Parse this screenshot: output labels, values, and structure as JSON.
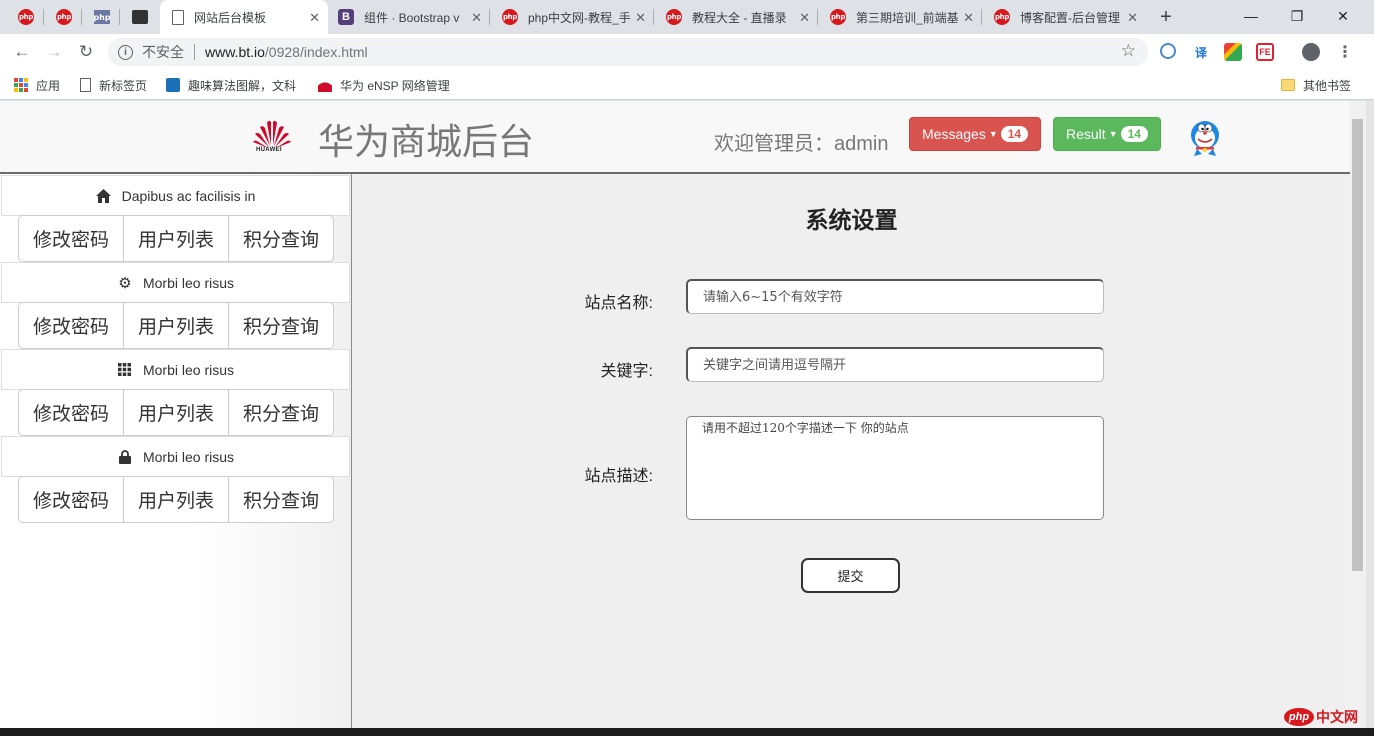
{
  "browser": {
    "tabs": [
      {
        "title": "网站后台模板",
        "active": true
      },
      {
        "title": "组件 · Bootstrap v"
      },
      {
        "title": "php中文网-教程_手"
      },
      {
        "title": "教程大全 - 直播录"
      },
      {
        "title": "第三期培训_前端基"
      },
      {
        "title": "博客配置-后台管理"
      }
    ],
    "pinned_tab_icons": [
      "php-icon",
      "php-icon",
      "php-box-icon",
      "github-icon"
    ],
    "security_label": "不安全",
    "url_host": "www.bt.io",
    "url_path": "/0928/index.html",
    "bookmarks": {
      "apps": "应用",
      "newtab": "新标签页",
      "algo": "趣味算法图解，文科",
      "huawei": "华为 eNSP 网络管理",
      "other": "其他书签"
    },
    "ext_translate": "译",
    "ext_fe": "FE"
  },
  "header": {
    "logo_word": "HUAWEI",
    "title": "华为商城后台",
    "welcome": "欢迎管理员：admin",
    "messages_label": "Messages",
    "messages_count": "14",
    "result_label": "Result",
    "result_count": "14"
  },
  "sidebar": {
    "panels": [
      {
        "heading": "Dapibus ac facilisis in",
        "icon": "home-icon",
        "buttons": [
          "修改密码",
          "用户列表",
          "积分查询"
        ]
      },
      {
        "heading": "Morbi leo risus",
        "icon": "gear-icon",
        "buttons": [
          "修改密码",
          "用户列表",
          "积分查询"
        ]
      },
      {
        "heading": "Morbi leo risus",
        "icon": "grid-icon",
        "buttons": [
          "修改密码",
          "用户列表",
          "积分查询"
        ]
      },
      {
        "heading": "Morbi leo risus",
        "icon": "lock-icon",
        "buttons": [
          "修改密码",
          "用户列表",
          "积分查询"
        ]
      }
    ]
  },
  "form": {
    "title": "系统设置",
    "site_name_label": "站点名称:",
    "site_name_placeholder": "请输入6~15个有效字符",
    "keywords_label": "关键字:",
    "keywords_placeholder": "关键字之间请用逗号隔开",
    "description_label": "站点描述:",
    "description_placeholder": "请用不超过120个字描述一下 你的站点",
    "submit_label": "提交"
  },
  "watermark": {
    "badge": "php",
    "text": "中文网"
  },
  "colors": {
    "danger": "#d9534f",
    "success": "#5cb85c",
    "huawei_red": "#cf0a2c"
  }
}
